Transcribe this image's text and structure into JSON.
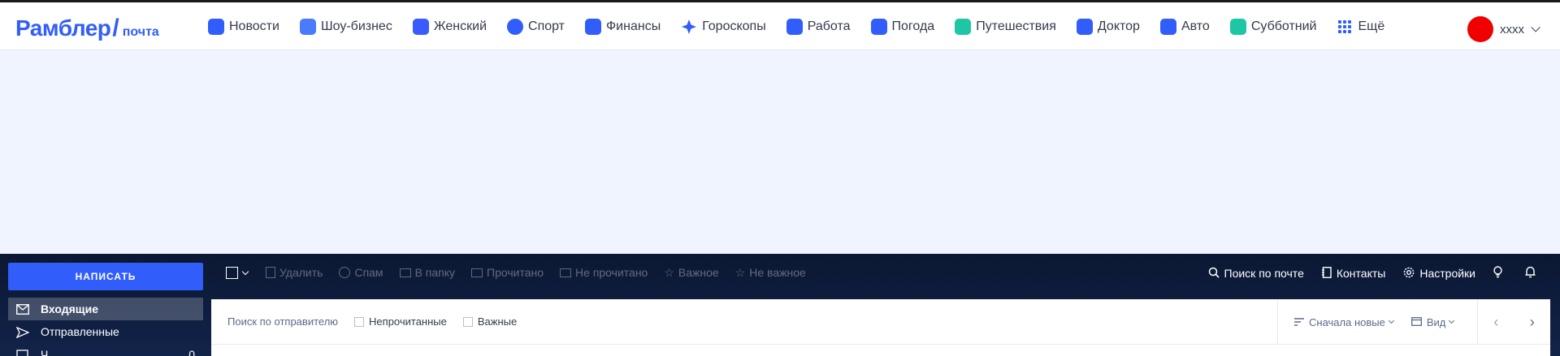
{
  "header": {
    "logo_main": "Рамблер",
    "logo_slash": "/",
    "logo_sub": "почта",
    "nav": [
      {
        "label": "Новости",
        "icon": "news-icon",
        "color": "#315efb"
      },
      {
        "label": "Шоу-бизнес",
        "icon": "microphone-icon",
        "color": "#4a7bff"
      },
      {
        "label": "Женский",
        "icon": "crown-icon",
        "color": "#3a5cff"
      },
      {
        "label": "Спорт",
        "icon": "ball-icon",
        "color": "#315efb"
      },
      {
        "label": "Финансы",
        "icon": "wallet-icon",
        "color": "#315efb"
      },
      {
        "label": "Гороскопы",
        "icon": "star-icon",
        "color": "#315efb"
      },
      {
        "label": "Работа",
        "icon": "briefcase-icon",
        "color": "#315efb"
      },
      {
        "label": "Погода",
        "icon": "umbrella-icon",
        "color": "#315efb"
      },
      {
        "label": "Путешествия",
        "icon": "palm-icon",
        "color": "#1fc6a6"
      },
      {
        "label": "Доктор",
        "icon": "medicine-icon",
        "color": "#315efb"
      },
      {
        "label": "Авто",
        "icon": "car-icon",
        "color": "#315efb"
      },
      {
        "label": "Субботний",
        "icon": "robot-icon",
        "color": "#1fc6a6"
      },
      {
        "label": "Ещё",
        "icon": "grid-icon",
        "color": "#315efb"
      }
    ],
    "user_name": "xxxx"
  },
  "sidebar": {
    "compose_label": "НАПИСАТЬ",
    "folders": [
      {
        "label": "Входящие",
        "icon": "inbox-icon",
        "count": ""
      },
      {
        "label": "Отправленные",
        "icon": "sent-icon",
        "count": ""
      },
      {
        "label": "Ч",
        "icon": "drafts-icon",
        "count": "0"
      }
    ]
  },
  "toolbar": {
    "items": [
      {
        "label": "Удалить",
        "icon": "trash-icon"
      },
      {
        "label": "Спам",
        "icon": "spam-icon"
      },
      {
        "label": "В папку",
        "icon": "folder-icon"
      },
      {
        "label": "Прочитано",
        "icon": "read-icon"
      },
      {
        "label": "Не прочитано",
        "icon": "unread-icon"
      },
      {
        "label": "Важное",
        "icon": "star-icon"
      },
      {
        "label": "Не важное",
        "icon": "star-outline-icon"
      }
    ],
    "right": [
      {
        "label": "Поиск по почте",
        "icon": "search-icon"
      },
      {
        "label": "Контакты",
        "icon": "contacts-icon"
      },
      {
        "label": "Настройки",
        "icon": "gear-icon"
      },
      {
        "label": "",
        "icon": "lightbulb-icon"
      },
      {
        "label": "",
        "icon": "bell-icon"
      }
    ]
  },
  "filters": {
    "sender_search": "Поиск по отправителю",
    "unread_label": "Непрочитанные",
    "important_label": "Важные",
    "sort_label": "Сначала новые",
    "view_label": "Вид"
  },
  "colors": {
    "brand": "#315efb",
    "avatar": "#f00000"
  }
}
